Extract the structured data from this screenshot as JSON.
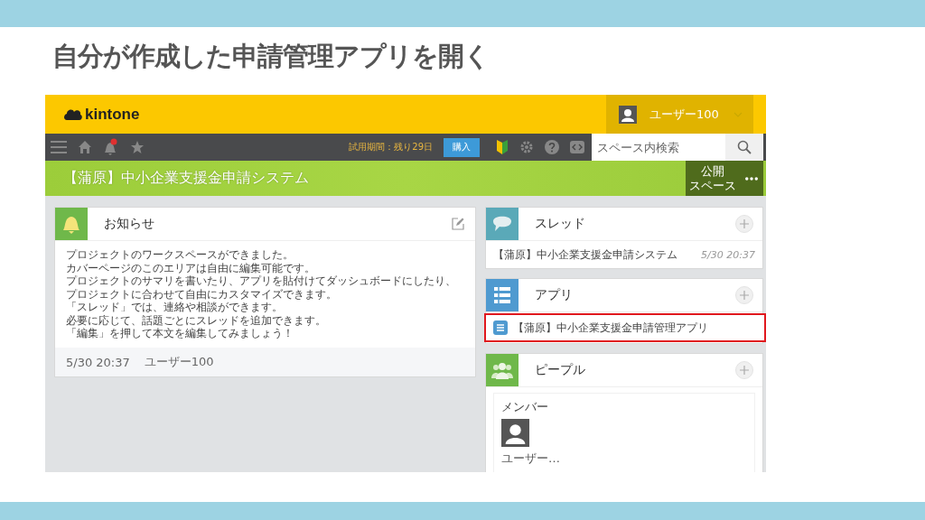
{
  "slide": {
    "title": "自分が作成した申請管理アプリを開く"
  },
  "header": {
    "logo": "kintone",
    "user": "ユーザー100"
  },
  "toolbar": {
    "trial": "試用期間：残り29日",
    "buy_button": "購入",
    "search": {
      "placeholder": "スペース内検索"
    }
  },
  "space": {
    "title": "【蒲原】中小企業支援金申請システム",
    "public_label": [
      "公開",
      "スペース"
    ]
  },
  "notice": {
    "title": "お知らせ",
    "lines": [
      "プロジェクトのワークスペースができました。",
      "カバーページのこのエリアは自由に編集可能です。",
      "プロジェクトのサマリを書いたり、アプリを貼付けてダッシュボードにしたり、",
      "プロジェクトに合わせて自由にカスタマイズできます。",
      "「スレッド」では、連絡や相談ができます。",
      "必要に応じて、話題ごとにスレッドを追加できます。",
      "「編集」を押して本文を編集してみましょう！"
    ],
    "date": "5/30 20:37",
    "author": "ユーザー100"
  },
  "threads": {
    "title": "スレッド",
    "items": [
      {
        "name": "【蒲原】中小企業支援金申請システム",
        "time": "5/30 20:37"
      }
    ]
  },
  "apps": {
    "title": "アプリ",
    "items": [
      {
        "name": "【蒲原】中小企業支援金申請管理アプリ",
        "highlighted": true
      }
    ]
  },
  "people": {
    "title": "ピープル",
    "section": "メンバー",
    "members": [
      {
        "name": "ユーザー…"
      }
    ]
  }
}
